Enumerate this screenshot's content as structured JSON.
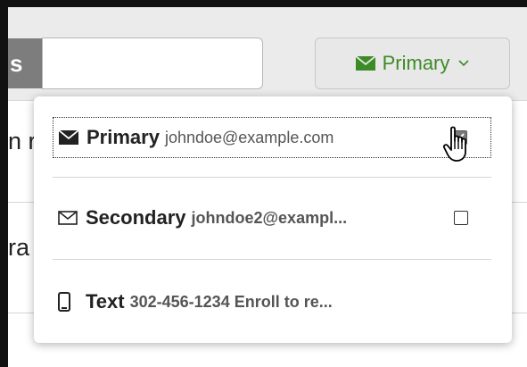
{
  "toolbar": {
    "prefix_text": "s",
    "input_value": "",
    "primary_button": {
      "label": "Primary",
      "icon": "envelope-filled-icon",
      "chevron": "⌵"
    }
  },
  "background": {
    "row1_text": "n r",
    "row2_text": "ra"
  },
  "dropdown": {
    "options": [
      {
        "name": "Primary",
        "detail": "johndoe@example.com",
        "icon": "envelope-filled-icon",
        "checked": true
      },
      {
        "name": "Secondary",
        "detail": "johndoe2@exampl...",
        "icon": "envelope-outline-icon",
        "checked": false
      },
      {
        "name": "Text",
        "detail": "302-456-1234 Enroll to re...",
        "icon": "mobile-phone-icon"
      }
    ]
  },
  "colors": {
    "accent_green": "#3d8b27",
    "toolbar_bg": "#ebebeb"
  }
}
